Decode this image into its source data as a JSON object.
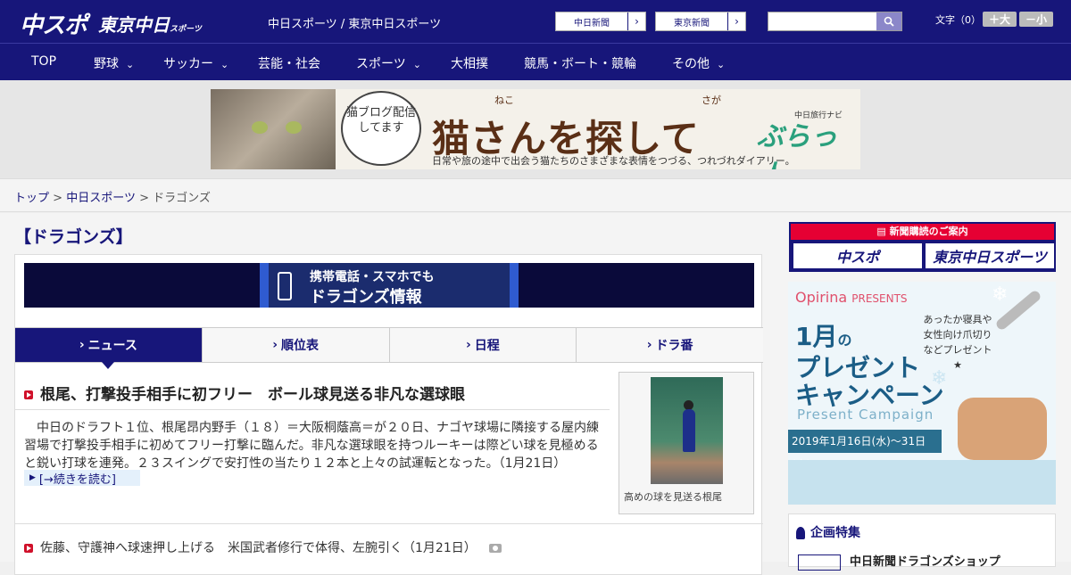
{
  "header": {
    "logo_main": "中スポ",
    "logo_tokyo": "東京中日",
    "logo_tokyo_sub": "スポーツ",
    "site_name": "中日スポーツ / 東京中日スポーツ",
    "newspaper_links": [
      "中日新聞",
      "東京新聞"
    ],
    "search_placeholder": "",
    "font_size_label": "文字（0）",
    "font_bigger": "＋大",
    "font_smaller": "－小"
  },
  "nav": {
    "items": [
      {
        "label": "TOP",
        "has_menu": false
      },
      {
        "label": "野球",
        "has_menu": true
      },
      {
        "label": "サッカー",
        "has_menu": true
      },
      {
        "label": "芸能・社会",
        "has_menu": false
      },
      {
        "label": "スポーツ",
        "has_menu": true
      },
      {
        "label": "大相撲",
        "has_menu": false
      },
      {
        "label": "競馬・ボート・競輪",
        "has_menu": false
      },
      {
        "label": "その他",
        "has_menu": true
      }
    ],
    "chevron": "⌄"
  },
  "ad_banner": {
    "bubble_text": "猫ブログ配信してます",
    "title": "猫さんを探して",
    "ruby_neko": "ねこ",
    "ruby_saga": "さが",
    "subtitle": "日常や旅の途中で出会う猫たちのさまざまな表情をつづる、つれづれダイアリー。",
    "brand_small": "中日旅行ナビ",
    "brand": "ぶらっ人"
  },
  "breadcrumb": {
    "items": [
      "トップ",
      "中日スポーツ",
      "ドラゴンズ"
    ],
    "separator": ">"
  },
  "page": {
    "title": "【ドラゴンズ】"
  },
  "mobile_banner": {
    "line1": "携帯電話・スマホでも",
    "line2": "ドラゴンズ情報"
  },
  "tabs": [
    {
      "label": "ニュース",
      "active": true
    },
    {
      "label": "順位表",
      "active": false
    },
    {
      "label": "日程",
      "active": false
    },
    {
      "label": "ドラ番",
      "active": false
    }
  ],
  "tab_prefix": "›",
  "article": {
    "headline": "根尾、打撃投手相手に初フリー　ボール球見送る非凡な選球眼",
    "body": "　中日のドラフト１位、根尾昂内野手（１８）＝大阪桐蔭高＝が２０日、ナゴヤ球場に隣接する屋内練習場で打撃投手相手に初めてフリー打撃に臨んだ。非凡な選球眼を持つルーキーは際どい球を見極めると鋭い打球を連発。２３スイングで安打性の当たり１２本と上々の試運転となった。（1月21日）",
    "read_more": "[→続きを読む]",
    "photo_caption": "高めの球を見送る根尾"
  },
  "news_list": [
    {
      "title": "佐藤、守護神へ球速押し上げる　米国武者修行で体得、左腕引く（1月21日）",
      "has_photo": true
    }
  ],
  "sidebar": {
    "subscribe_title": "新聞購読のご案内",
    "subscribe_buttons": [
      "中スポ",
      "東京中日スポーツ"
    ],
    "ad": {
      "brand": "Opirina",
      "brand_suffix": "PRESENTS",
      "copy": "あったか寝具や女性向け爪切りなどプレゼント★",
      "big_line1": "1月",
      "big_line1_suffix": "の",
      "big_line2": "プレゼント",
      "big_line3": "キャンペーン",
      "english": "Present Campaign",
      "dates": "2019年1月16日(水)～31日(木)"
    },
    "features_title": "企画特集",
    "features_first": "中日新聞ドラゴンズショップ"
  },
  "colors": {
    "brand_navy": "#17167a",
    "accent_red": "#d0102a",
    "subscribe_red": "#e60033"
  }
}
